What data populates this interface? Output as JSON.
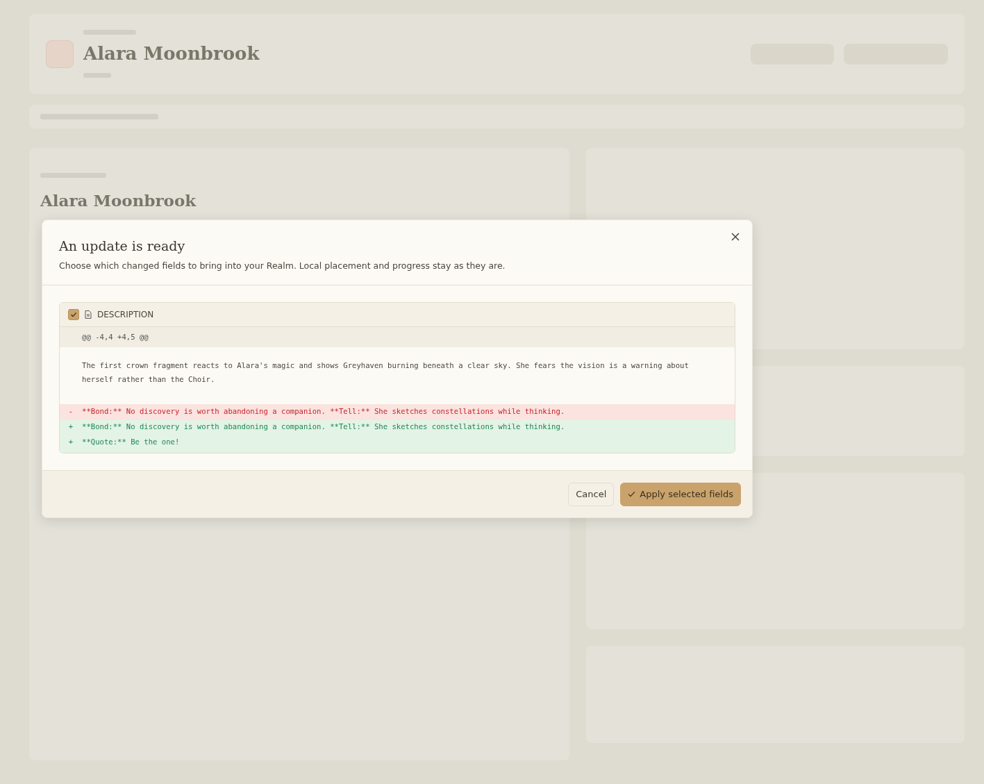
{
  "background": {
    "header_title": "Alara Moonbrook",
    "card_title": "Alara Moonbrook"
  },
  "dialog": {
    "title": "An update is ready",
    "subtitle": "Choose which changed fields to bring into your Realm. Local placement and progress stay as they are.",
    "fields": [
      {
        "label": "DESCRIPTION",
        "checked": true,
        "hunk": "@@ -4,4 +4,5 @@",
        "lines": [
          {
            "kind": "context",
            "text": "The first crown fragment reacts to Alara's magic and shows Greyhaven burning beneath a clear sky. She fears the vision is a warning about herself rather than the Choir."
          },
          {
            "kind": "removed",
            "sign": "-",
            "text": "**Bond:** No discovery is worth abandoning a companion. **Tell:** She sketches constellations while thinking."
          },
          {
            "kind": "added",
            "sign": "+",
            "text": "**Bond:** No discovery is worth abandoning a companion. **Tell:** She sketches constellations while thinking."
          },
          {
            "kind": "added",
            "sign": "+",
            "text": "**Quote:** Be the one!"
          }
        ]
      }
    ],
    "buttons": [
      {
        "kind": "secondary",
        "label": "Cancel"
      },
      {
        "kind": "primary",
        "label": "Apply selected fields"
      }
    ]
  }
}
